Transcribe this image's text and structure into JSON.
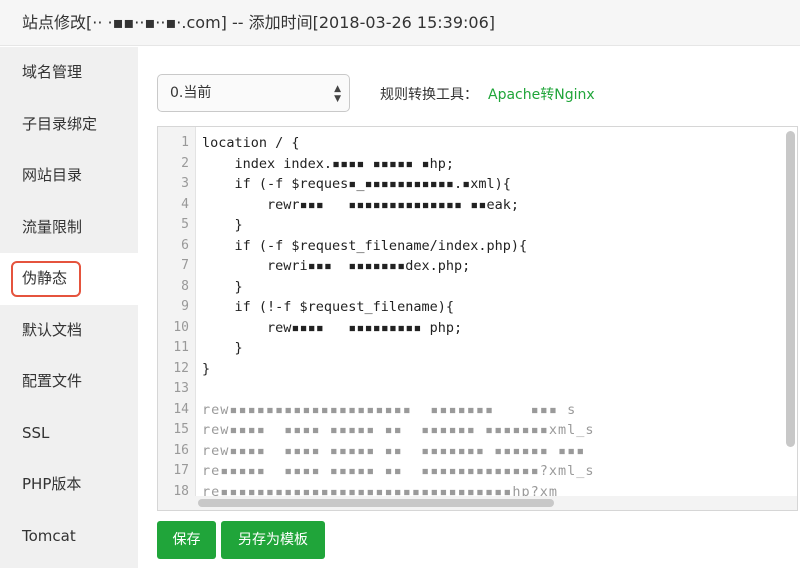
{
  "window": {
    "title": "站点修改[·· ·▪▪··▪··▪·.com] -- 添加时间[2018-03-26 15:39:06]"
  },
  "sidebar": {
    "items": [
      {
        "label": "域名管理"
      },
      {
        "label": "子目录绑定"
      },
      {
        "label": "网站目录"
      },
      {
        "label": "流量限制"
      },
      {
        "label": "伪静态"
      },
      {
        "label": "默认文档"
      },
      {
        "label": "配置文件"
      },
      {
        "label": "SSL"
      },
      {
        "label": "PHP版本"
      },
      {
        "label": "Tomcat"
      }
    ],
    "active_index": 4
  },
  "rewrite": {
    "selected_rule": "0.当前",
    "tool_label": "规则转换工具：",
    "tool_link": "Apache转Nginx"
  },
  "editor": {
    "line_numbers": [
      "1",
      "2",
      "3",
      "4",
      "5",
      "6",
      "7",
      "8",
      "9",
      "10",
      "11",
      "12",
      "13",
      "14",
      "15",
      "16",
      "17",
      "18"
    ],
    "lines": [
      "location / {",
      "    index index.▪▪▪▪ ▪▪▪▪▪ ▪hp;",
      "    if (-f $reques▪_▪▪▪▪▪▪▪▪▪▪▪.▪xml){",
      "        rewr▪▪▪   ▪▪▪▪▪▪▪▪▪▪▪▪▪▪ ▪▪eak;",
      "    }",
      "    if (-f $request_filename/index.php){",
      "        rewri▪▪▪  ▪▪▪▪▪▪▪dex.php;",
      "    }",
      "    if (!-f $request_filename){",
      "        rew▪▪▪▪   ▪▪▪▪▪▪▪▪▪ php;",
      "    }",
      "}",
      "",
      "rew▪▪▪▪▪▪▪▪▪▪▪▪▪▪▪▪▪▪▪▪  ▪▪▪▪▪▪▪    ▪▪▪ s",
      "rew▪▪▪▪  ▪▪▪▪ ▪▪▪▪▪ ▪▪  ▪▪▪▪▪▪ ▪▪▪▪▪▪▪xml_s",
      "rew▪▪▪▪  ▪▪▪▪ ▪▪▪▪▪ ▪▪  ▪▪▪▪▪▪▪ ▪▪▪▪▪▪ ▪▪▪",
      "re▪▪▪▪▪  ▪▪▪▪ ▪▪▪▪▪ ▪▪  ▪▪▪▪▪▪▪▪▪▪▪▪▪?xml_s",
      "re▪▪▪▪▪▪▪▪▪▪▪▪▪▪▪▪▪▪▪▪▪▪▪▪▪▪▪▪▪▪▪▪hp?xm"
    ]
  },
  "buttons": {
    "save": "保存",
    "save_as_template": "另存为模板"
  },
  "colors": {
    "accent_green": "#20a53a",
    "highlight_red": "#e5533d"
  }
}
